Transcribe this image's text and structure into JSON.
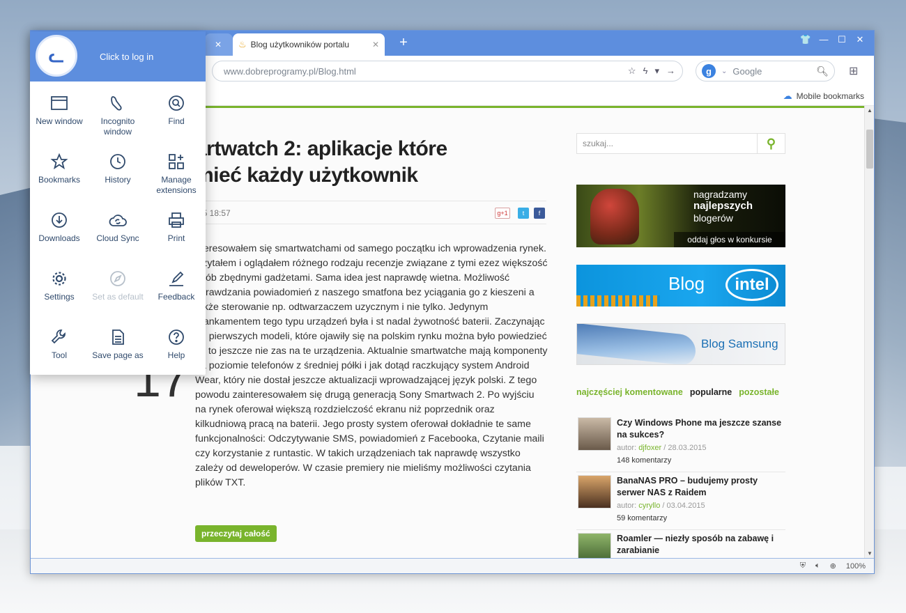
{
  "browser": {
    "tab_active_title": "Blog użytkowników portalu",
    "url_domain": "www.dobreprogramy.pl",
    "url_path": "/Blog.html",
    "search_engine": "Google",
    "search_badge": "g",
    "bookmarks_mobile": "Mobile bookmarks",
    "zoom": "100%",
    "accent_color": "#5d8ede"
  },
  "menu": {
    "login_text": "Click to log in",
    "items": [
      {
        "label": "New window",
        "icon": "window-icon",
        "enabled": true
      },
      {
        "label": "Incognito window",
        "icon": "incognito-icon",
        "enabled": true
      },
      {
        "label": "Find",
        "icon": "find-icon",
        "enabled": true
      },
      {
        "label": "Bookmarks",
        "icon": "star-icon",
        "enabled": true
      },
      {
        "label": "History",
        "icon": "clock-icon",
        "enabled": true
      },
      {
        "label": "Manage extensions",
        "icon": "extensions-icon",
        "enabled": true
      },
      {
        "label": "Downloads",
        "icon": "download-icon",
        "enabled": true
      },
      {
        "label": "Cloud Sync",
        "icon": "cloud-sync-icon",
        "enabled": true
      },
      {
        "label": "Print",
        "icon": "printer-icon",
        "enabled": true
      },
      {
        "label": "Settings",
        "icon": "gear-icon",
        "enabled": true
      },
      {
        "label": "Set as default",
        "icon": "compass-icon",
        "enabled": false
      },
      {
        "label": "Feedback",
        "icon": "pen-icon",
        "enabled": true
      },
      {
        "label": "Tool",
        "icon": "wrench-icon",
        "enabled": true
      },
      {
        "label": "Save page as",
        "icon": "document-icon",
        "enabled": true
      },
      {
        "label": "Help",
        "icon": "help-icon",
        "enabled": true
      }
    ]
  },
  "article": {
    "title": "artwatch 2: aplikacje które\nmieć każdy użytkownik",
    "date": "15 18:57",
    "big_number": "17",
    "body": "nteresowałem się smartwatchami od samego początku ich wprowadzenia rynek. Czytałem i oglądałem różnego rodzaju recenzje związane z tymi ezez większość osób zbędnymi gadżetami. Sama idea jest naprawdę wietna. Możliwość sprawdzania powiadomień z naszego smatfona bez yciągania go z kieszeni a także sterowanie np. odtwarzaczem uzycznym i nie tylko. Jedynym mankamentem tego typu urządzeń była i st nadal żywotność baterii. Zaczynając od pierwszych modeli, które ojawiły się na polskim rynku można było powiedzieć że to jeszcze nie zas na te urządzenia. Aktualnie smartwatche mają komponenty na poziomie telefonów z średniej półki i jak dotąd raczkujący system Android Wear, który nie dostał jeszcze aktualizacji wprowadzającej język polski. Z tego powodu zainteresowałem się drugą generacją Sony Smartwach 2. Po wyjściu na rynek oferował większą rozdzielczość ekranu niż poprzednik oraz kilkudniową pracą na baterii. Jego prosty system oferował dokładnie te same funkcjonalności: Odczytywanie SMS, powiadomień z Facebooka, Czytanie maili czy korzystanie z runtastic. W takich urządzeniach tak naprawdę wszystko zależy od deweloperów. W czasie premiery nie mieliśmy możliwości czytania plików TXT.",
    "read_more": "przeczytaj całość",
    "gplus": "g+1",
    "twitter": "t",
    "facebook": "f"
  },
  "sidebar": {
    "search_placeholder": "szukaj...",
    "banner1": {
      "l1": "nagradzamy",
      "l2": "najlepszych",
      "l3": "blogerów",
      "bar": "oddaj głos w konkursie"
    },
    "banner2": {
      "word": "Blog",
      "brand": "intel"
    },
    "banner3": {
      "word": "Blog Samsung"
    },
    "tabs": [
      "najczęściej komentowane",
      "popularne",
      "pozostałe"
    ],
    "posts": [
      {
        "title": "Czy Windows Phone ma jeszcze szanse na sukces?",
        "author_prefix": "autor: ",
        "author": "djfoxer",
        "date": " / 28.03.2015",
        "comments": "148 komentarzy"
      },
      {
        "title": "BanaNAS PRO – budujemy prosty serwer NAS z Raidem",
        "author_prefix": "autor: ",
        "author": "cyryllo",
        "date": " / 03.04.2015",
        "comments": "59 komentarzy"
      },
      {
        "title": "Roamler — niezły sposób na zabawę i zarabianie",
        "author_prefix": "",
        "author": "",
        "date": "",
        "comments": ""
      }
    ]
  }
}
